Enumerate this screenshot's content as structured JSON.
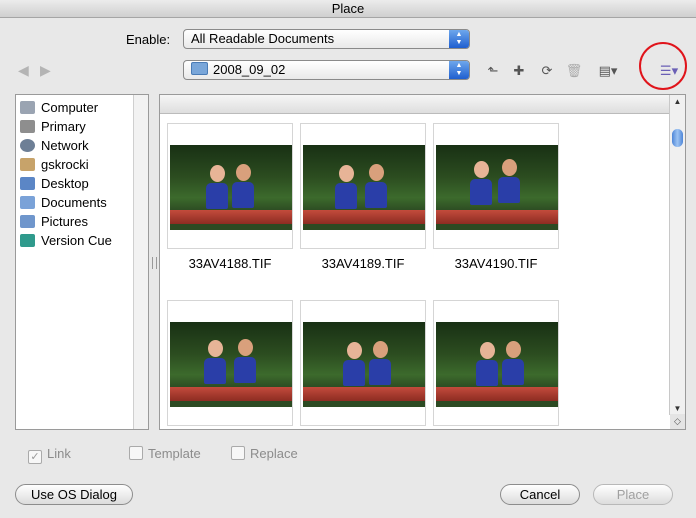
{
  "window": {
    "title": "Place"
  },
  "enable": {
    "label": "Enable:",
    "selected": "All Readable Documents"
  },
  "location": {
    "selected": "2008_09_02"
  },
  "toolbar": {
    "nav_back_icon": "back-arrow-icon",
    "nav_forward_icon": "forward-arrow-icon",
    "view_menu_glyph": "▾"
  },
  "sidebar": {
    "items": [
      {
        "label": "Computer",
        "icon": "computer-icon"
      },
      {
        "label": "Primary",
        "icon": "drive-icon"
      },
      {
        "label": "Network",
        "icon": "network-icon"
      },
      {
        "label": "gskrocki",
        "icon": "home-icon"
      },
      {
        "label": "Desktop",
        "icon": "desktop-icon"
      },
      {
        "label": "Documents",
        "icon": "documents-icon"
      },
      {
        "label": "Pictures",
        "icon": "pictures-icon"
      },
      {
        "label": "Version Cue",
        "icon": "version-cue-icon"
      }
    ]
  },
  "files": [
    {
      "name": "33AV4188.TIF"
    },
    {
      "name": "33AV4189.TIF"
    },
    {
      "name": "33AV4190.TIF"
    },
    {
      "name": ""
    },
    {
      "name": ""
    },
    {
      "name": ""
    }
  ],
  "options": {
    "link": "Link",
    "template": "Template",
    "replace": "Replace"
  },
  "buttons": {
    "os_dialog": "Use OS Dialog",
    "cancel": "Cancel",
    "place": "Place"
  },
  "colors": {
    "accent": "#2a66d6",
    "annotation": "#e0141b"
  }
}
